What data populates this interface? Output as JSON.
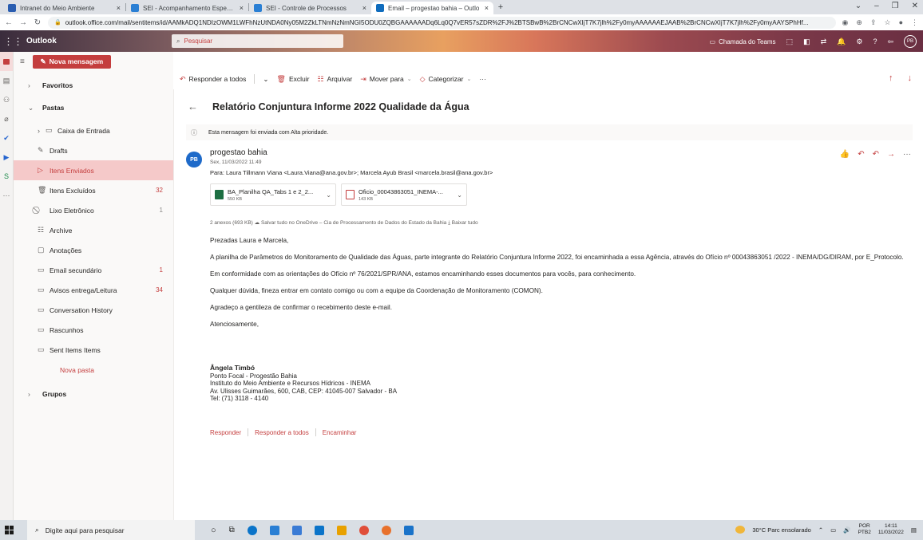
{
  "browser": {
    "tabs": [
      {
        "title": "Intranet do Meio Ambiente",
        "favicon_color": "#2a5db0",
        "active": false
      },
      {
        "title": "SEI - Acompanhamento Especial",
        "favicon_color": "#2a7fd4",
        "active": false
      },
      {
        "title": "SEI - Controle de Processos",
        "favicon_color": "#2a7fd4",
        "active": false
      },
      {
        "title": "Email – progestao bahia – Outlo",
        "favicon_color": "#0f6cbd",
        "active": true
      }
    ],
    "new_tab_label": "+",
    "close_glyph": "×",
    "url": "outlook.office.com/mail/sentitems/id/AAMkADQ1NDIzOWM1LWFhNzUtNDA0Ny05M2ZkLTNmNzNmNGI5ODU0ZQBGAAAAAADq6Lq0Q7vER57sZDR%2FJ%2BTSBwB%2BrCNCwXIjT7K7jlh%2Fy0myAAAAAAEJAAB%2BrCNCwXIjT7K7jlh%2Fy0myAAYSPhHf..."
  },
  "outlook": {
    "brand": "Outlook",
    "search_placeholder": "Pesquisar",
    "teams_label": "Chamada do Teams",
    "user_initials": "PB"
  },
  "sidebar": {
    "new_message_label": "Nova mensagem",
    "favorites_label": "Favoritos",
    "folders_label": "Pastas",
    "groups_label": "Grupos",
    "new_folder_label": "Nova pasta",
    "items": [
      {
        "label": "Caixa de Entrada",
        "icon": "inbox-icon",
        "count": "",
        "active": false,
        "has_chevron": true
      },
      {
        "label": "Drafts",
        "icon": "pencil-icon",
        "count": "",
        "active": false
      },
      {
        "label": "Itens Enviados",
        "icon": "send-icon",
        "count": "",
        "active": true
      },
      {
        "label": "Itens Excluídos",
        "icon": "trash-icon",
        "count": "32",
        "active": false
      },
      {
        "label": "Lixo Eletrônico",
        "icon": "block-icon",
        "count": "1",
        "active": false,
        "count_grey": true
      },
      {
        "label": "Archive",
        "icon": "archive-icon",
        "count": "",
        "active": false
      },
      {
        "label": "Anotações",
        "icon": "note-icon",
        "count": "",
        "active": false
      },
      {
        "label": "Email secundário",
        "icon": "folder-icon",
        "count": "1",
        "active": false
      },
      {
        "label": "Avisos entrega/Leitura",
        "icon": "folder-icon",
        "count": "34",
        "active": false
      },
      {
        "label": "Conversation History",
        "icon": "folder-icon",
        "count": "",
        "active": false
      },
      {
        "label": "Rascunhos",
        "icon": "folder-icon",
        "count": "",
        "active": false
      },
      {
        "label": "Sent Items Items",
        "icon": "folder-icon",
        "count": "",
        "active": false
      }
    ]
  },
  "commands": {
    "reply_all": "Responder a todos",
    "delete": "Excluir",
    "archive": "Arquivar",
    "move_to": "Mover para",
    "categorize": "Categorizar",
    "more": "···"
  },
  "message": {
    "subject": "Relatório Conjuntura Informe 2022 Qualidade da Água",
    "priority_notice": "Esta mensagem foi enviada com Alta prioridade.",
    "sender_initials": "PB",
    "sender_name": "progestao bahia",
    "date": "Sex, 11/03/2022 11:49",
    "to_line": "Para: Laura Tillmann Viana <Laura.Viana@ana.gov.br>; Marcela Ayub Brasil <marcela.brasil@ana.gov.br>",
    "attachments": [
      {
        "name": "BA_Planilha QA_Tabs 1 e 2_2...",
        "size": "550 KB",
        "type": "xls"
      },
      {
        "name": "Oficio_00043863051_INEMA-...",
        "size": "143 KB",
        "type": "pdf"
      }
    ],
    "attachments_meta": "2 anexos (693 KB)   ☁ Salvar tudo no OneDrive – Cia de Processamento de Dados do Estado da Bahia   ⤓ Baixar tudo",
    "greeting": "Prezadas Laura e Marcela,",
    "para1": "A planilha de Parâmetros do Monitoramento de Qualidade das Águas, parte integrante do Relatório Conjuntura Informe 2022, foi encaminhada a essa Agência, através do Ofício nº 00043863051 /2022 - INEMA/DG/DIRAM, por E_Protocolo.",
    "para2": "Em conformidade com as orientações do Ofício nº 76/2021/SPR/ANA, estamos encaminhando esses documentos para vocês, para conhecimento.",
    "para3": "Qualquer dúvida, fineza entrar em contato comigo ou com a equipe da Coordenação de Monitoramento (COMON).",
    "para4": "Agradeço a gentileza de confirmar o recebimento deste e-mail.",
    "closing": "Atenciosamente,",
    "signature": {
      "name": "Ângela Timbó",
      "line1": "Ponto Focal - Progestão Bahia",
      "line2": "Instituto do Meio Ambiente e Recursos Hídricos - INEMA",
      "line3": "Av. Ulisses Guimarães, 600, CAB, CEP: 41045-007 Salvador - BA",
      "line4": "Tel: (71) 3118 - 4140"
    },
    "reply_label": "Responder",
    "reply_all_label": "Responder a todos",
    "forward_label": "Encaminhar"
  },
  "taskbar": {
    "search_placeholder": "Digite aqui para pesquisar",
    "weather": "30°C  Parc ensolarado",
    "lang_top": "POR",
    "lang_bottom": "PTB2",
    "time": "14:11",
    "date": "11/03/2022",
    "app_colors": [
      "#1a1a1a",
      "#1a1a1a",
      "#0078d4",
      "#2a7fd4",
      "#3a7bd5",
      "#0b74c9",
      "#e8a100",
      "#e04e39",
      "#e8712c",
      "#1a73c9"
    ]
  },
  "colors": {
    "accent": "#c43e3e",
    "active_folder_bg": "#f5c9c9"
  }
}
